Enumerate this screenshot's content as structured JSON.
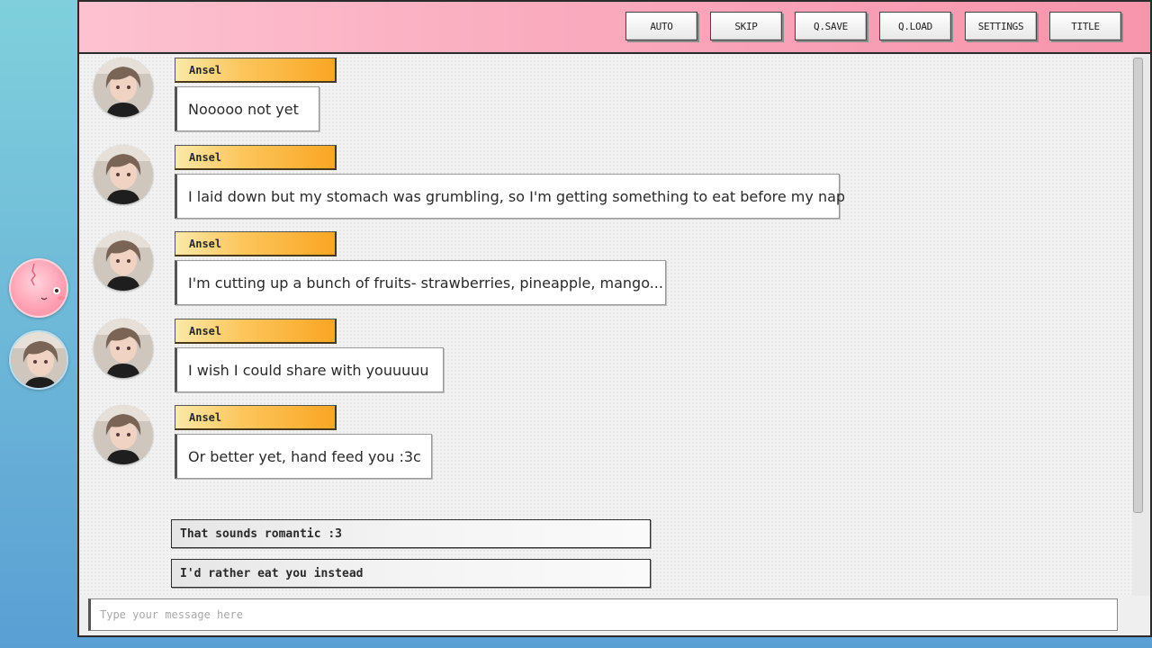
{
  "toolbar": {
    "auto": "AUTO",
    "skip": "SKIP",
    "qsave": "Q.SAVE",
    "qload": "Q.LOAD",
    "settings": "SETTINGS",
    "title": "TITLE"
  },
  "contacts": [
    {
      "icon": "pink-blob-avatar-icon"
    },
    {
      "icon": "ansel-avatar-icon"
    }
  ],
  "messages": [
    {
      "sender": "Ansel",
      "text": "Nooooo not yet"
    },
    {
      "sender": "Ansel",
      "text": "I laid down but my stomach was grumbling, so I'm getting something to eat before my nap"
    },
    {
      "sender": "Ansel",
      "text": "I'm cutting up a bunch of fruits- strawberries, pineapple, mango..."
    },
    {
      "sender": "Ansel",
      "text": "I wish I could share with youuuuu"
    },
    {
      "sender": "Ansel",
      "text": "Or better yet, hand feed you :3c"
    }
  ],
  "choices": [
    {
      "text": "That sounds romantic :3"
    },
    {
      "text": "I'd rather eat you instead"
    }
  ],
  "input": {
    "placeholder": "Type your message here",
    "value": ""
  },
  "colors": {
    "topbar": "#f9a3b8",
    "name_tag": "#fcc75e",
    "background": "#7fd0dc"
  }
}
